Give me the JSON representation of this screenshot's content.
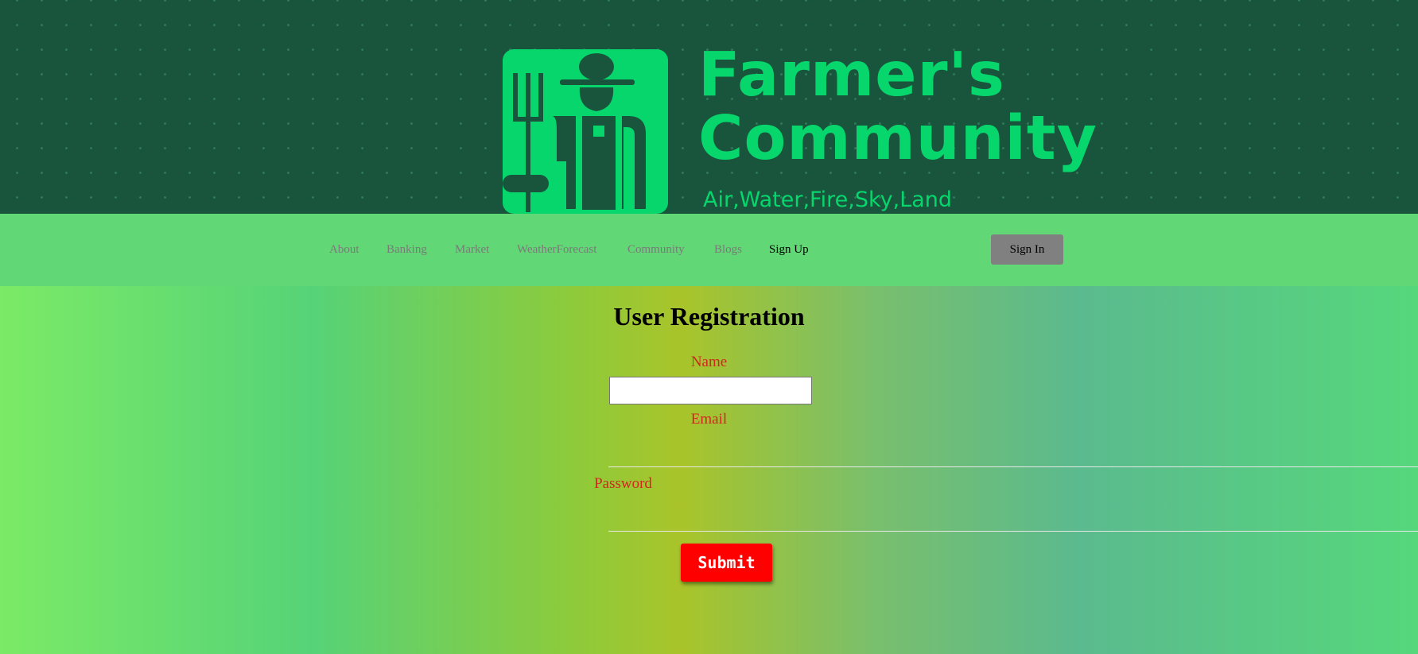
{
  "header": {
    "brand_line1": "Farmer's",
    "brand_line2": "Community",
    "tagline": "Air,Water,Fire,Sky,Land"
  },
  "nav": {
    "links": [
      {
        "label": "About"
      },
      {
        "label": "Banking"
      },
      {
        "label": "Market"
      },
      {
        "label": "WeatherForecast"
      },
      {
        "label": "Community"
      },
      {
        "label": "Blogs"
      },
      {
        "label": "Sign Up",
        "active": true
      }
    ],
    "signin_label": "Sign In"
  },
  "form": {
    "title": "User Registration",
    "name_label": "Name",
    "name_value": "",
    "email_label": "Email",
    "email_value": "",
    "password_label": "Password",
    "password_value": "",
    "submit_label": "Submit"
  },
  "colors": {
    "banner": "#19543d",
    "brand_green": "#06d66c",
    "navbar": "#62d775",
    "label_red": "#d1271e",
    "submit": "#ff0000",
    "signin": "#808080"
  }
}
